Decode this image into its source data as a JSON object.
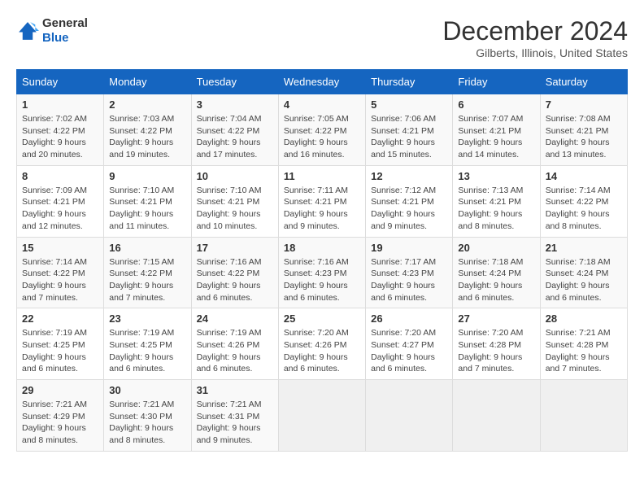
{
  "header": {
    "logo_general": "General",
    "logo_blue": "Blue",
    "month_year": "December 2024",
    "location": "Gilberts, Illinois, United States"
  },
  "weekdays": [
    "Sunday",
    "Monday",
    "Tuesday",
    "Wednesday",
    "Thursday",
    "Friday",
    "Saturday"
  ],
  "weeks": [
    [
      {
        "day": "1",
        "sunrise": "7:02 AM",
        "sunset": "4:22 PM",
        "daylight": "9 hours and 20 minutes."
      },
      {
        "day": "2",
        "sunrise": "7:03 AM",
        "sunset": "4:22 PM",
        "daylight": "9 hours and 19 minutes."
      },
      {
        "day": "3",
        "sunrise": "7:04 AM",
        "sunset": "4:22 PM",
        "daylight": "9 hours and 17 minutes."
      },
      {
        "day": "4",
        "sunrise": "7:05 AM",
        "sunset": "4:22 PM",
        "daylight": "9 hours and 16 minutes."
      },
      {
        "day": "5",
        "sunrise": "7:06 AM",
        "sunset": "4:21 PM",
        "daylight": "9 hours and 15 minutes."
      },
      {
        "day": "6",
        "sunrise": "7:07 AM",
        "sunset": "4:21 PM",
        "daylight": "9 hours and 14 minutes."
      },
      {
        "day": "7",
        "sunrise": "7:08 AM",
        "sunset": "4:21 PM",
        "daylight": "9 hours and 13 minutes."
      }
    ],
    [
      {
        "day": "8",
        "sunrise": "7:09 AM",
        "sunset": "4:21 PM",
        "daylight": "9 hours and 12 minutes."
      },
      {
        "day": "9",
        "sunrise": "7:10 AM",
        "sunset": "4:21 PM",
        "daylight": "9 hours and 11 minutes."
      },
      {
        "day": "10",
        "sunrise": "7:10 AM",
        "sunset": "4:21 PM",
        "daylight": "9 hours and 10 minutes."
      },
      {
        "day": "11",
        "sunrise": "7:11 AM",
        "sunset": "4:21 PM",
        "daylight": "9 hours and 9 minutes."
      },
      {
        "day": "12",
        "sunrise": "7:12 AM",
        "sunset": "4:21 PM",
        "daylight": "9 hours and 9 minutes."
      },
      {
        "day": "13",
        "sunrise": "7:13 AM",
        "sunset": "4:21 PM",
        "daylight": "9 hours and 8 minutes."
      },
      {
        "day": "14",
        "sunrise": "7:14 AM",
        "sunset": "4:22 PM",
        "daylight": "9 hours and 8 minutes."
      }
    ],
    [
      {
        "day": "15",
        "sunrise": "7:14 AM",
        "sunset": "4:22 PM",
        "daylight": "9 hours and 7 minutes."
      },
      {
        "day": "16",
        "sunrise": "7:15 AM",
        "sunset": "4:22 PM",
        "daylight": "9 hours and 7 minutes."
      },
      {
        "day": "17",
        "sunrise": "7:16 AM",
        "sunset": "4:22 PM",
        "daylight": "9 hours and 6 minutes."
      },
      {
        "day": "18",
        "sunrise": "7:16 AM",
        "sunset": "4:23 PM",
        "daylight": "9 hours and 6 minutes."
      },
      {
        "day": "19",
        "sunrise": "7:17 AM",
        "sunset": "4:23 PM",
        "daylight": "9 hours and 6 minutes."
      },
      {
        "day": "20",
        "sunrise": "7:18 AM",
        "sunset": "4:24 PM",
        "daylight": "9 hours and 6 minutes."
      },
      {
        "day": "21",
        "sunrise": "7:18 AM",
        "sunset": "4:24 PM",
        "daylight": "9 hours and 6 minutes."
      }
    ],
    [
      {
        "day": "22",
        "sunrise": "7:19 AM",
        "sunset": "4:25 PM",
        "daylight": "9 hours and 6 minutes."
      },
      {
        "day": "23",
        "sunrise": "7:19 AM",
        "sunset": "4:25 PM",
        "daylight": "9 hours and 6 minutes."
      },
      {
        "day": "24",
        "sunrise": "7:19 AM",
        "sunset": "4:26 PM",
        "daylight": "9 hours and 6 minutes."
      },
      {
        "day": "25",
        "sunrise": "7:20 AM",
        "sunset": "4:26 PM",
        "daylight": "9 hours and 6 minutes."
      },
      {
        "day": "26",
        "sunrise": "7:20 AM",
        "sunset": "4:27 PM",
        "daylight": "9 hours and 6 minutes."
      },
      {
        "day": "27",
        "sunrise": "7:20 AM",
        "sunset": "4:28 PM",
        "daylight": "9 hours and 7 minutes."
      },
      {
        "day": "28",
        "sunrise": "7:21 AM",
        "sunset": "4:28 PM",
        "daylight": "9 hours and 7 minutes."
      }
    ],
    [
      {
        "day": "29",
        "sunrise": "7:21 AM",
        "sunset": "4:29 PM",
        "daylight": "9 hours and 8 minutes."
      },
      {
        "day": "30",
        "sunrise": "7:21 AM",
        "sunset": "4:30 PM",
        "daylight": "9 hours and 8 minutes."
      },
      {
        "day": "31",
        "sunrise": "7:21 AM",
        "sunset": "4:31 PM",
        "daylight": "9 hours and 9 minutes."
      },
      null,
      null,
      null,
      null
    ]
  ],
  "labels": {
    "sunrise": "Sunrise:",
    "sunset": "Sunset:",
    "daylight": "Daylight:"
  }
}
